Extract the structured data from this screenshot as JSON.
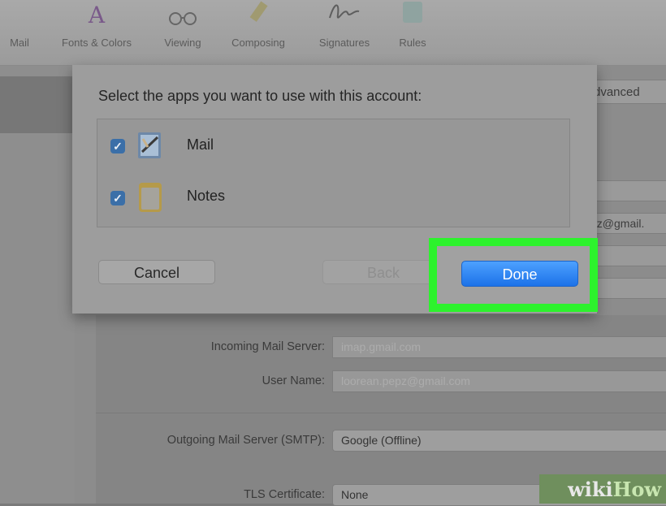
{
  "toolbar": {
    "items": [
      {
        "label": "Mail",
        "icon": "mail-icon"
      },
      {
        "label": "Fonts & Colors",
        "icon": "fonts-colors-icon"
      },
      {
        "label": "Viewing",
        "icon": "viewing-glasses-icon"
      },
      {
        "label": "Composing",
        "icon": "composing-pencil-icon"
      },
      {
        "label": "Signatures",
        "icon": "signature-icon"
      },
      {
        "label": "Rules",
        "icon": "rules-icon"
      }
    ]
  },
  "background": {
    "advanced_tab": "dvanced",
    "email_field": "pz@gmail.",
    "incoming_server_label": "Incoming Mail Server:",
    "incoming_server_value": "imap.gmail.com",
    "username_label": "User Name:",
    "username_value": "loorean.pepz@gmail.com",
    "outgoing_label": "Outgoing Mail Server (SMTP):",
    "outgoing_value": "Google (Offline)",
    "tls_label": "TLS Certificate:",
    "tls_value": "None"
  },
  "dialog": {
    "title": "Select the apps you want to use with this account:",
    "apps": [
      {
        "label": "Mail",
        "checked": true,
        "icon": "mail-app-icon"
      },
      {
        "label": "Notes",
        "checked": true,
        "icon": "notes-app-icon"
      }
    ],
    "cancel_label": "Cancel",
    "back_label": "Back",
    "done_label": "Done"
  },
  "watermark": {
    "wiki": "wiki",
    "how": "How"
  },
  "colors": {
    "highlight": "#2df22d",
    "done_button": "#2a80f0",
    "checkbox": "#3b6fa8"
  }
}
